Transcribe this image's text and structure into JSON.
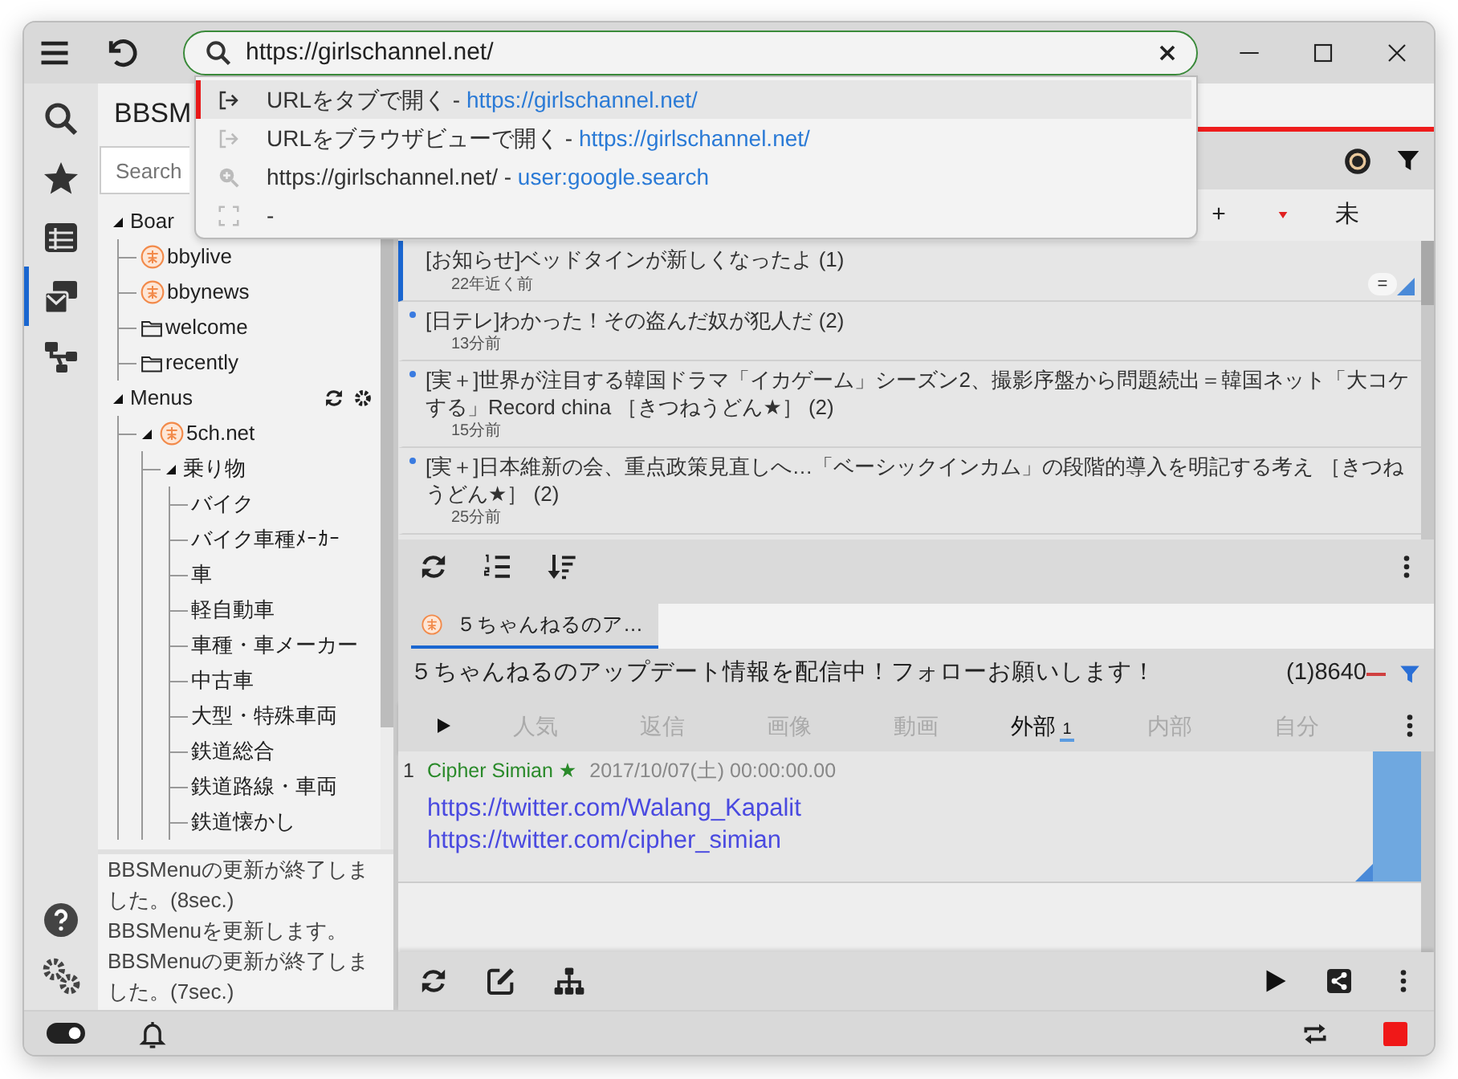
{
  "titlebar": {
    "url": "https://girlschannel.net/"
  },
  "suggestions": [
    {
      "kind": "open-tab",
      "label": "URLをタブで開く",
      "separator": "-",
      "link": "https://girlschannel.net/",
      "selected": true
    },
    {
      "kind": "open-browser",
      "label": "URLをブラウザビューで開く",
      "separator": "-",
      "link": "https://girlschannel.net/",
      "selected": false
    },
    {
      "kind": "search",
      "label": "https://girlschannel.net/",
      "separator": "-",
      "link": "user:google.search",
      "selected": false
    },
    {
      "kind": "fullscreen",
      "separator": "-",
      "selected": false
    }
  ],
  "rail": [
    {
      "kind": "search",
      "selected": false
    },
    {
      "kind": "favorites",
      "selected": false
    },
    {
      "kind": "list",
      "selected": false
    },
    {
      "kind": "boards",
      "selected": true
    },
    {
      "kind": "tree",
      "selected": false
    }
  ],
  "sidebar": {
    "title": "BBSM",
    "search": {
      "placeholder": "Search"
    },
    "tree": [
      {
        "label": "Boar",
        "kind": "root",
        "expanded": true,
        "children": [
          {
            "label": "bbylive",
            "kind": "site"
          },
          {
            "label": "bbynews",
            "kind": "site"
          },
          {
            "label": "welcome",
            "kind": "folder"
          },
          {
            "label": "recently",
            "kind": "folder"
          }
        ]
      },
      {
        "label": "Menus",
        "kind": "menu-root",
        "expanded": true,
        "children": [
          {
            "label": "5ch.net",
            "kind": "site",
            "expanded": true,
            "children": [
              {
                "label": "乗り物",
                "expanded": true,
                "children": [
                  {
                    "label": "バイク"
                  },
                  {
                    "label": "バイク車種ﾒｰｶｰ"
                  },
                  {
                    "label": "車"
                  },
                  {
                    "label": "軽自動車"
                  },
                  {
                    "label": "車種・車メーカー"
                  },
                  {
                    "label": "中古車"
                  },
                  {
                    "label": "大型・特殊車両"
                  },
                  {
                    "label": "鉄道総合"
                  },
                  {
                    "label": "鉄道路線・車両"
                  },
                  {
                    "label": "鉄道懐かし"
                  }
                ]
              }
            ]
          }
        ]
      }
    ],
    "log": [
      "BBSMenuの更新が終了しました。(8sec.)",
      "BBSMenuを更新します。",
      "BBSMenuの更新が終了しました。(7sec.)"
    ]
  },
  "board_columns": [
    "+",
    "未"
  ],
  "threads": [
    {
      "title": "[お知らせ]ベッドタインが新しくなったよ (1)",
      "age": "22年近く前",
      "selected": true,
      "unread": false,
      "badge": "="
    },
    {
      "title": "[日テレ]わかった！その盗んだ奴が犯人だ (2)",
      "age": "13分前",
      "selected": false,
      "unread": true
    },
    {
      "title": "[実＋]世界が注目する韓国ドラマ「イカゲーム」シーズン2、撮影序盤から問題続出＝韓国ネット「大コケする」Record china ［きつねうどん★］ (2)",
      "age": "15分前",
      "selected": false,
      "unread": true
    },
    {
      "title": "[実＋]日本維新の会、重点政策見直しへ…「ベーシックインカム」の段階的導入を明記する考え ［きつねうどん★］ (2)",
      "age": "25分前",
      "selected": false,
      "unread": true
    }
  ],
  "thread_tabs": [
    {
      "label": "５ちゃんねるのア…",
      "selected": true
    }
  ],
  "thread": {
    "title": "５ちゃんねるのアップデート情報を配信中！フォローお願いします！",
    "count": "(1)8640",
    "filters": [
      {
        "label": "人気",
        "selected": false
      },
      {
        "label": "返信",
        "selected": false
      },
      {
        "label": "画像",
        "selected": false
      },
      {
        "label": "動画",
        "selected": false
      },
      {
        "label": "外部",
        "count": "1",
        "selected": true
      },
      {
        "label": "内部",
        "selected": false
      },
      {
        "label": "自分",
        "selected": false
      }
    ],
    "posts": [
      {
        "number": "1",
        "name": "Cipher Simian ★",
        "date": "2017/10/07(土) 00:00:00.00",
        "lines": [
          "https://twitter.com/Walang_Kapalit",
          "https://twitter.com/cipher_simian"
        ]
      }
    ]
  },
  "status": {
    "toggle_on": true
  }
}
